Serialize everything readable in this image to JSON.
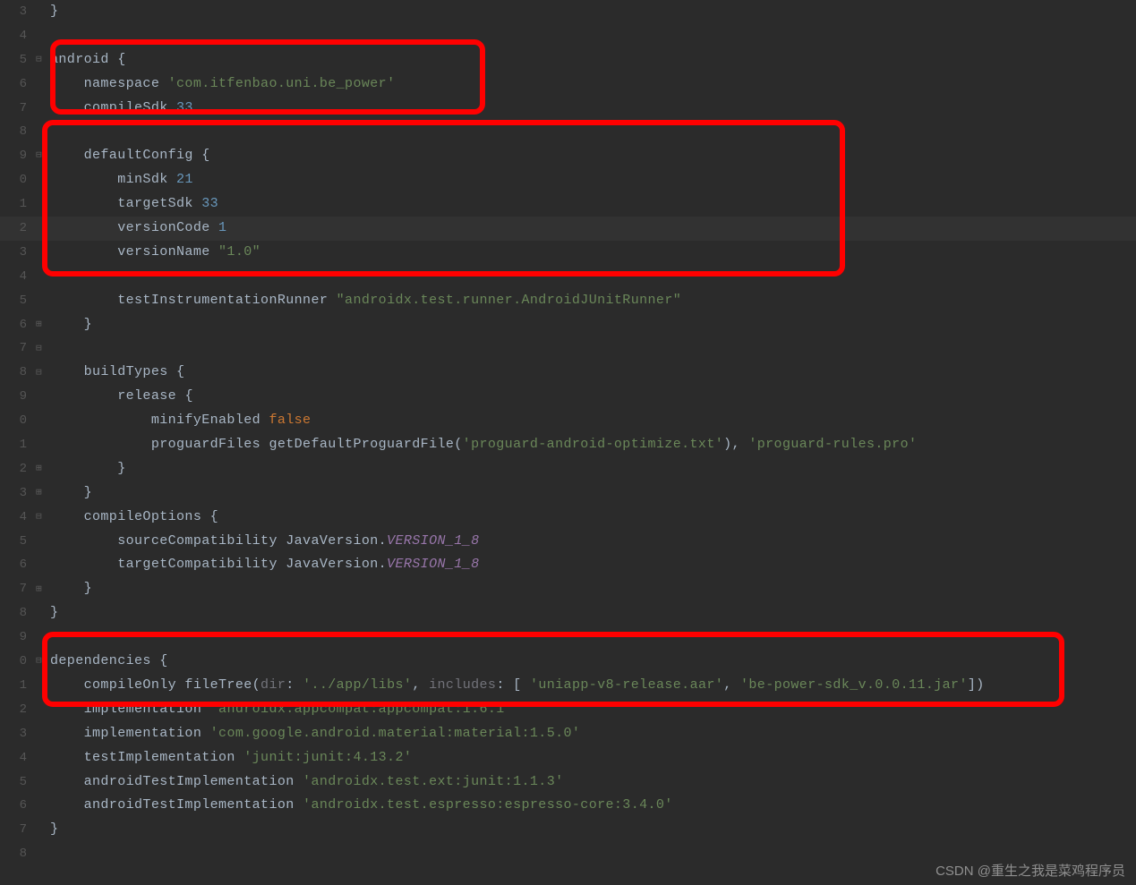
{
  "gutter": [
    "3",
    "4",
    "5",
    "6",
    "7",
    "8",
    "9",
    "0",
    "1",
    "2",
    "3",
    "4",
    "5",
    "6",
    "7",
    "8",
    "9",
    "0",
    "1",
    "2",
    "3",
    "4",
    "5",
    "6",
    "7",
    "8",
    "9",
    "0",
    "1",
    "2",
    "3",
    "4",
    "5",
    "6",
    "7",
    "8"
  ],
  "folds": [
    {
      "row": 2,
      "glyph": "⊟"
    },
    {
      "row": 6,
      "glyph": "⊟"
    },
    {
      "row": 13,
      "glyph": "⊞"
    },
    {
      "row": 14,
      "glyph": "⊟"
    },
    {
      "row": 15,
      "glyph": "⊟"
    },
    {
      "row": 18,
      "glyph": "⊞"
    },
    {
      "row": 19,
      "glyph": "⊞"
    },
    {
      "row": 21,
      "glyph": "⊟"
    },
    {
      "row": 24,
      "glyph": "⊞"
    },
    {
      "row": 27,
      "glyph": "⊟"
    }
  ],
  "code": {
    "r0": "}",
    "r2a": "android ",
    "r2b": "{",
    "r3a": "    namespace ",
    "r3b": "'com.itfenbao.uni.be_power'",
    "r4a": "    compileSdk ",
    "r4b": "33",
    "r6a": "    defaultConfig ",
    "r6b": "{",
    "r7a": "        minSdk ",
    "r7b": "21",
    "r8a": "        targetSdk ",
    "r8b": "33",
    "r9a": "        versionCode ",
    "r9b": "1",
    "r10a": "        versionName ",
    "r10b": "\"1.0\"",
    "r12a": "        testInstrumentationRunner ",
    "r12b": "\"androidx.test.runner.AndroidJUnitRunner\"",
    "r13": "    }",
    "r15a": "    buildTypes ",
    "r15b": "{",
    "r16a": "        release ",
    "r16b": "{",
    "r17a": "            minifyEnabled ",
    "r17b": "false",
    "r18a": "            proguardFiles getDefaultProguardFile(",
    "r18b": "'proguard-android-optimize.txt'",
    "r18c": "), ",
    "r18d": "'proguard-rules.pro'",
    "r19": "        }",
    "r20": "    }",
    "r21a": "    compileOptions ",
    "r21b": "{",
    "r22a": "        sourceCompatibility JavaVersion.",
    "r22b": "VERSION_1_8",
    "r23a": "        targetCompatibility JavaVersion.",
    "r23b": "VERSION_1_8",
    "r24": "    }",
    "r25": "}",
    "r27a": "dependencies ",
    "r27b": "{",
    "r28a": "    compileOnly fileTree(",
    "r28b": "dir",
    "r28c": ": ",
    "r28d": "'../app/libs'",
    "r28e": ", ",
    "r28f": "includes",
    "r28g": ": [ ",
    "r28h": "'uniapp-v8-release.aar'",
    "r28i": ", ",
    "r28j": "'be-power-sdk_v.0.0.11.jar'",
    "r28k": "])",
    "r29a": "    implementation ",
    "r29b": "'androidx.appcompat:appcompat:1.6.1'",
    "r30a": "    implementation ",
    "r30b": "'com.google.android.material:material:1.5.0'",
    "r31a": "    testImplementation ",
    "r31b": "'junit:junit:4.13.2'",
    "r32a": "    androidTestImplementation ",
    "r32b": "'androidx.test.ext:junit:1.1.3'",
    "r33a": "    androidTestImplementation ",
    "r33b": "'androidx.test.espresso:espresso-core:3.4.0'",
    "r34": "}"
  },
  "watermark": "CSDN @重生之我是菜鸡程序员"
}
